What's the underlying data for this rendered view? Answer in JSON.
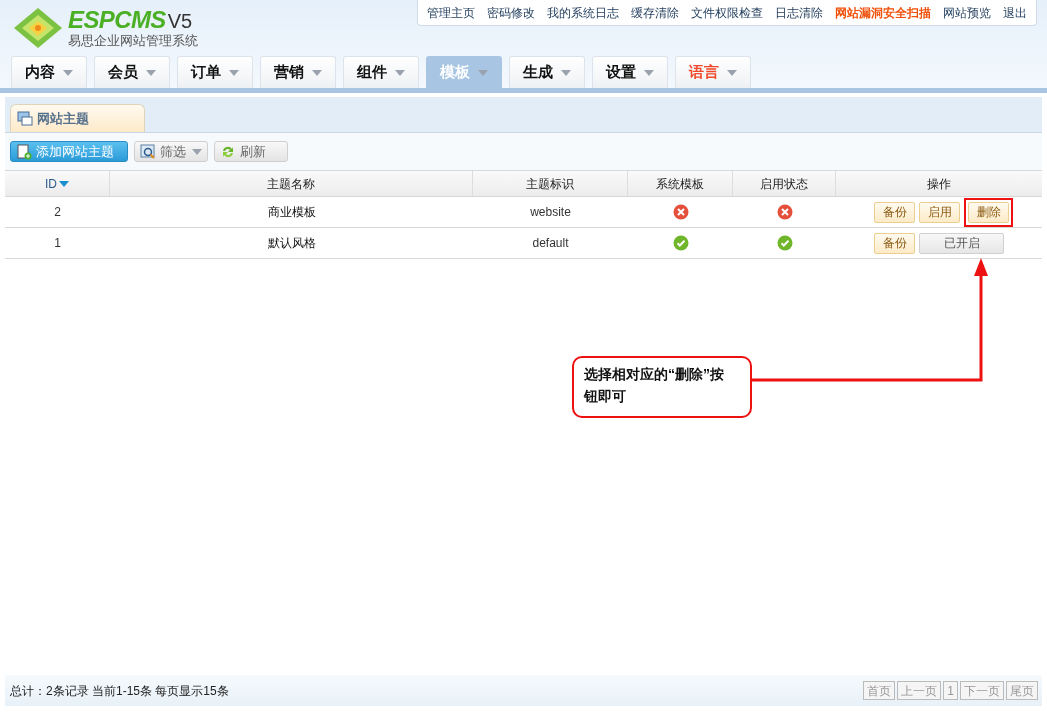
{
  "logo": {
    "brand": "ESPCMS",
    "version": "V5",
    "subtitle": "易思企业网站管理系统"
  },
  "top_links": [
    {
      "label": "管理主页",
      "emphasis": false
    },
    {
      "label": "密码修改",
      "emphasis": false
    },
    {
      "label": "我的系统日志",
      "emphasis": false
    },
    {
      "label": "缓存清除",
      "emphasis": false
    },
    {
      "label": "文件权限检查",
      "emphasis": false
    },
    {
      "label": "日志清除",
      "emphasis": false
    },
    {
      "label": "网站漏洞安全扫描",
      "emphasis": true
    },
    {
      "label": "网站预览",
      "emphasis": false
    },
    {
      "label": "退出",
      "emphasis": false
    }
  ],
  "nav_tabs": [
    {
      "label": "内容",
      "selected": false,
      "emphasis": false
    },
    {
      "label": "会员",
      "selected": false,
      "emphasis": false
    },
    {
      "label": "订单",
      "selected": false,
      "emphasis": false
    },
    {
      "label": "营销",
      "selected": false,
      "emphasis": false
    },
    {
      "label": "组件",
      "selected": false,
      "emphasis": false
    },
    {
      "label": "模板",
      "selected": true,
      "emphasis": false
    },
    {
      "label": "生成",
      "selected": false,
      "emphasis": false
    },
    {
      "label": "设置",
      "selected": false,
      "emphasis": false
    },
    {
      "label": "语言",
      "selected": false,
      "emphasis": true
    }
  ],
  "panel_tab": "网站主题",
  "toolbar": [
    {
      "label": "添加网站主题",
      "kind": "primary"
    },
    {
      "label": "筛选",
      "kind": "filter"
    },
    {
      "label": "刷新",
      "kind": "refresh"
    }
  ],
  "table": {
    "columns": [
      "ID",
      "主题名称",
      "主题标识",
      "系统模板",
      "启用状态",
      "操作"
    ],
    "rows": [
      {
        "id": "2",
        "name": "商业模板",
        "ident": "website",
        "system": false,
        "enabled": false,
        "actions": [
          {
            "label": "备份",
            "disabled": false,
            "highlighted": false
          },
          {
            "label": "启用",
            "disabled": false,
            "highlighted": false
          },
          {
            "label": "删除",
            "disabled": false,
            "highlighted": true
          }
        ]
      },
      {
        "id": "1",
        "name": "默认风格",
        "ident": "default",
        "system": true,
        "enabled": true,
        "actions": [
          {
            "label": "备份",
            "disabled": false,
            "highlighted": false
          },
          {
            "label": "已开启",
            "disabled": true,
            "highlighted": false
          }
        ]
      }
    ]
  },
  "callout": "选择相对应的“删除”按钮即可",
  "footer": {
    "summary": "总计：2条记录 当前1-15条 每页显示15条",
    "pager": [
      "首页",
      "上一页",
      "1",
      "下一页",
      "尾页"
    ]
  }
}
